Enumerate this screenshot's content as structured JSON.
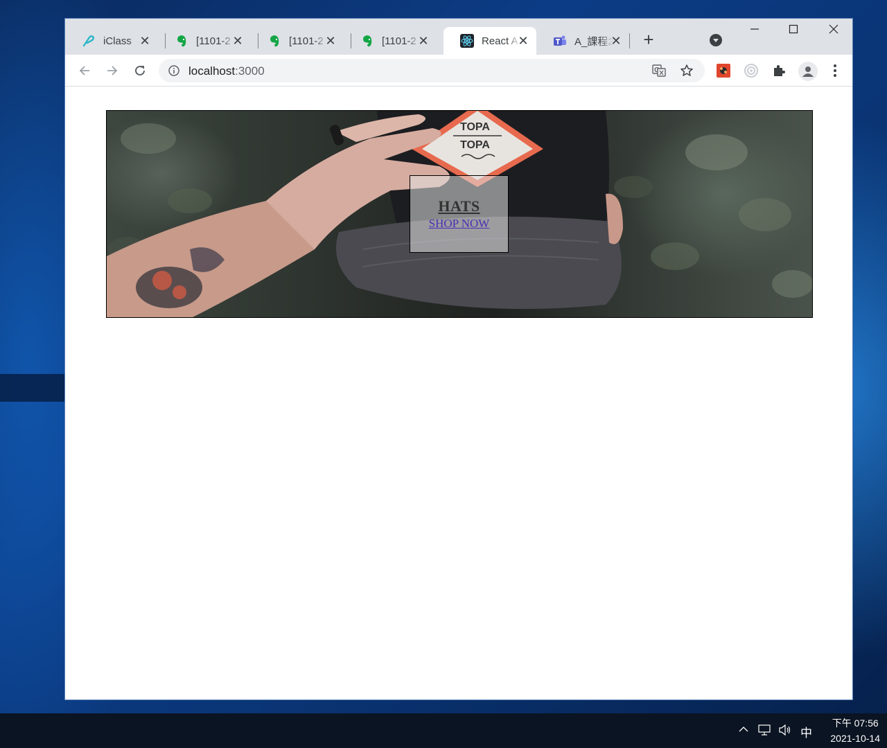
{
  "browser": {
    "tabs": [
      {
        "title": "iClass",
        "icon": "iclass-icon"
      },
      {
        "title": "[1101-2",
        "icon": "evernote-icon"
      },
      {
        "title": "[1101-2",
        "icon": "evernote-icon"
      },
      {
        "title": "[1101-2",
        "icon": "evernote-icon"
      },
      {
        "title": "React A",
        "icon": "react-icon",
        "active": true
      },
      {
        "title": "A_課程2",
        "icon": "teams-icon"
      }
    ],
    "close_glyph": "✕",
    "new_tab_glyph": "+",
    "window_controls": {
      "minimize": "—",
      "maximize": "☐",
      "close": "✕"
    },
    "address": {
      "host": "localhost",
      "port": ":3000"
    }
  },
  "page": {
    "banner": {
      "title": "HATS",
      "subtitle": "SHOP NOW"
    }
  },
  "taskbar": {
    "ime": "中",
    "time": "下午 07:56",
    "date": "2021-10-14"
  },
  "colors": {
    "tab_bar": "#dee1e6",
    "active_tab": "#ffffff",
    "link": "#4b2fb4",
    "taskbar": "#0b1422"
  }
}
